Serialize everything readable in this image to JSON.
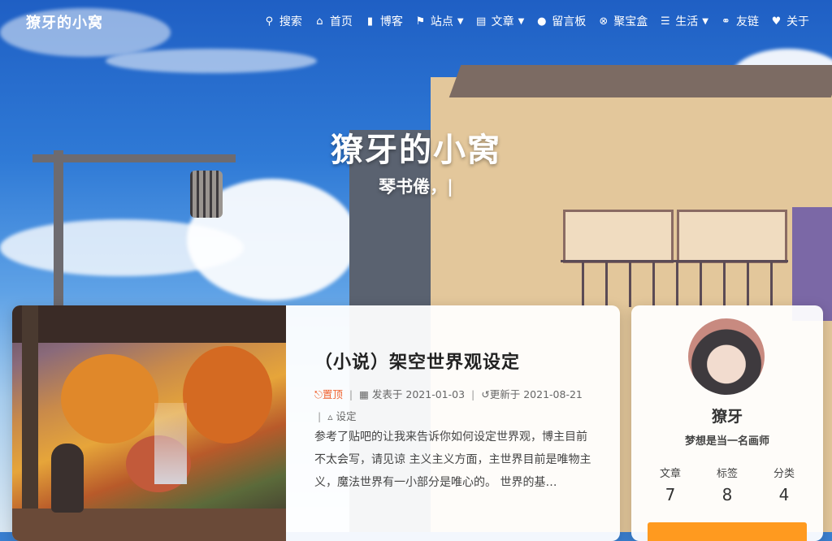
{
  "site": {
    "brand": "獠牙的小窝"
  },
  "nav": {
    "items": [
      {
        "label": "搜索",
        "icon": "search-icon"
      },
      {
        "label": "首页",
        "icon": "home-icon"
      },
      {
        "label": "博客",
        "icon": "book-icon"
      },
      {
        "label": "站点",
        "icon": "flag-icon",
        "dropdown": true
      },
      {
        "label": "文章",
        "icon": "file-icon",
        "dropdown": true
      },
      {
        "label": "留言板",
        "icon": "comment-icon"
      },
      {
        "label": "聚宝盒",
        "icon": "xbox-icon"
      },
      {
        "label": "生活",
        "icon": "list-icon",
        "dropdown": true
      },
      {
        "label": "友链",
        "icon": "link-icon"
      },
      {
        "label": "关于",
        "icon": "heart-icon"
      }
    ]
  },
  "hero": {
    "title": "獠牙的小窝",
    "subtitle": "琴书倦，|"
  },
  "post": {
    "title": "（小说）架空世界观设定",
    "pinned": "置顶",
    "published_label": "发表于",
    "published": "2021-01-03",
    "updated_label": "更新于",
    "updated": "2021-08-21",
    "category": "设定",
    "excerpt": "参考了贴吧的让我来告诉你如何设定世界观，博主目前不太会写，请见谅 主义主义方面，主世界目前是唯物主义，魔法世界有一小部分是唯心的。 世界的基…"
  },
  "profile": {
    "name": "獠牙",
    "description": "梦想是当一名画师",
    "stats": [
      {
        "label": "文章",
        "value": "7"
      },
      {
        "label": "标签",
        "value": "8"
      },
      {
        "label": "分类",
        "value": "4"
      }
    ]
  },
  "colors": {
    "accent": "#ff9a1f",
    "pin": "#f0622e"
  }
}
